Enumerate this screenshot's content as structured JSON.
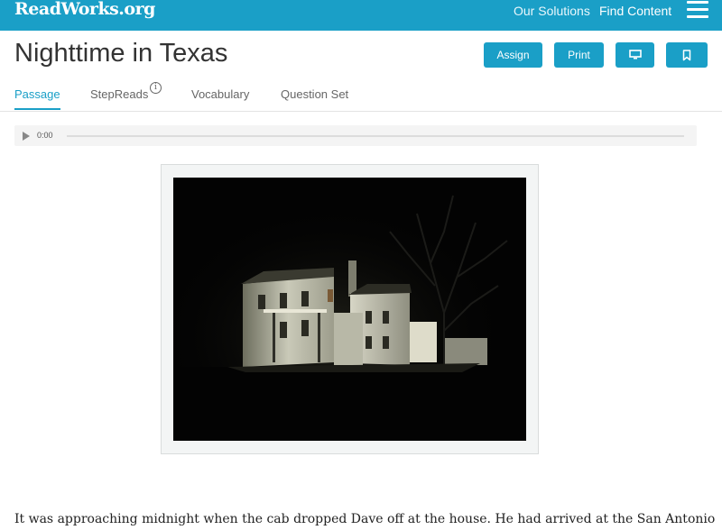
{
  "topbar": {
    "logo": "ReadWorks.org",
    "nav": [
      "Our Solutions",
      "Find Content"
    ],
    "menu_icon": "hamburger-icon"
  },
  "header": {
    "title": "Nighttime in Texas",
    "buttons": {
      "assign": "Assign",
      "print": "Print",
      "present_icon": "monitor-icon",
      "bookmark_icon": "bookmark-icon"
    }
  },
  "tabs": [
    {
      "label": "Passage",
      "active": true
    },
    {
      "label": "StepReads",
      "info_icon": "info-icon"
    },
    {
      "label": "Vocabulary"
    },
    {
      "label": "Question Set"
    }
  ],
  "audio": {
    "time": "0:00",
    "progress": 0
  },
  "passage": {
    "first_line": "It was approaching midnight when the cab dropped Dave off at the house. He had arrived at the San Antonio"
  },
  "colors": {
    "brand": "#1a9fc7",
    "text": "#333333"
  }
}
